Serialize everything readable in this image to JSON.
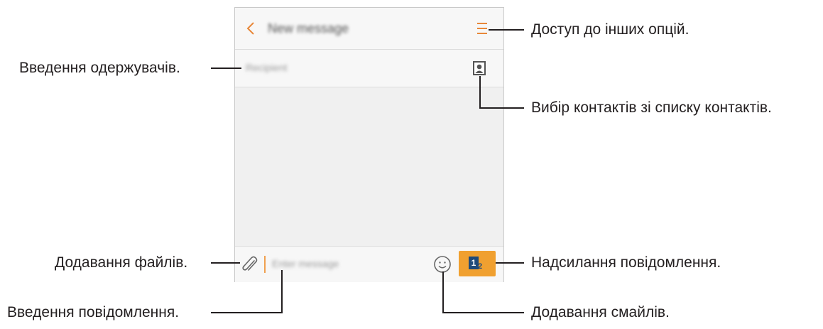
{
  "app": {
    "title": "New message",
    "recipient_placeholder": "Recipient",
    "message_placeholder": "Enter message",
    "send_sim_primary": "1",
    "send_sim_secondary": "2"
  },
  "callouts": {
    "more_options": "Доступ до інших опцій.",
    "enter_recipients": "Введення одержувачів.",
    "select_contacts": "Вибір контактів зі списку контактів.",
    "attach_files": "Додавання файлів.",
    "send_message": "Надсилання повідомлення.",
    "enter_message": "Введення повідомлення.",
    "add_emoticons": "Додавання смайлів."
  },
  "colors": {
    "accent": "#f0a030",
    "icon_orange": "#e8883a",
    "sim_blue": "#1f4a7a",
    "leader_line": "#231f20"
  }
}
